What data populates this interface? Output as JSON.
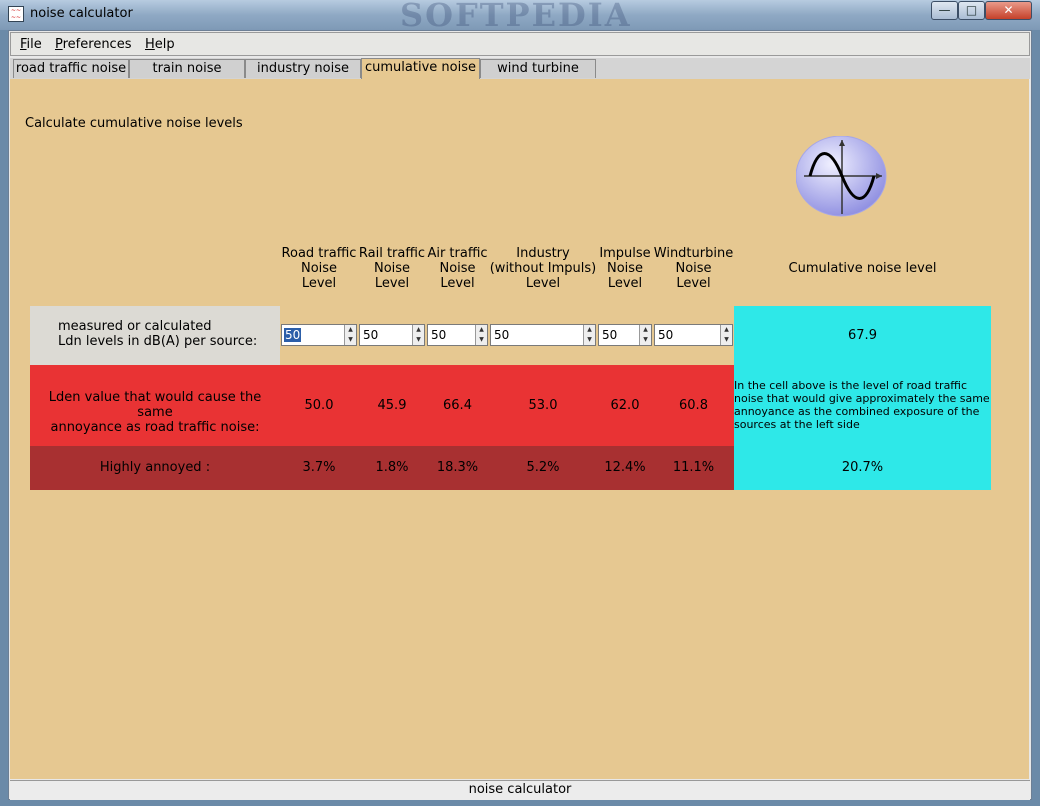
{
  "window": {
    "title": "noise calculator",
    "watermark": "SOFTPEDIA",
    "icon": "sine-wave-app-icon"
  },
  "menu": [
    {
      "label": "File",
      "mnemonic": "F"
    },
    {
      "label": "Preferences",
      "mnemonic": "P"
    },
    {
      "label": "Help",
      "mnemonic": "H"
    }
  ],
  "tabs": [
    {
      "label": "road traffic noise",
      "active": false
    },
    {
      "label": "train noise",
      "active": false
    },
    {
      "label": "industry noise",
      "active": false
    },
    {
      "label": "cumulative noise",
      "active": true
    },
    {
      "label": "wind turbine",
      "active": false
    }
  ],
  "page": {
    "heading": "Calculate cumulative noise levels",
    "logo_icon": "sine-wave-graph-icon"
  },
  "columns": [
    {
      "lines": [
        "Road traffic",
        "Noise",
        "Level"
      ]
    },
    {
      "lines": [
        "Rail traffic",
        "Noise",
        "Level"
      ]
    },
    {
      "lines": [
        "Air traffic",
        "Noise",
        "Level"
      ]
    },
    {
      "lines": [
        "Industry",
        "(without Impuls)",
        "Level"
      ]
    },
    {
      "lines": [
        "Impulse",
        "Noise",
        "Level"
      ]
    },
    {
      "lines": [
        "Windturbine",
        "Noise",
        "Level"
      ]
    }
  ],
  "cumulative_header": "Cumulative noise level",
  "rows": {
    "input_label_line1": "measured or calculated",
    "input_label_line2": "Ldn levels in dB(A) per source:",
    "inputs": [
      "50",
      "50",
      "50",
      "50",
      "50",
      "50"
    ],
    "lden_label_line1": "Lden value that would cause the same",
    "lden_label_line2": "annoyance as road traffic noise:",
    "lden_values": [
      "50.0",
      "45.9",
      "66.4",
      "53.0",
      "62.0",
      "60.8"
    ],
    "annoyed_label": "Highly annoyed :",
    "annoyed_values": [
      "3.7%",
      "1.8%",
      "18.3%",
      "5.2%",
      "12.4%",
      "11.1%"
    ]
  },
  "cumulative": {
    "level": "67.9",
    "explanation": "In the cell above is the level of road traffic noise that would give approximately the same annoyance as the combined exposure of the sources at the left side",
    "annoyed": "20.7%"
  },
  "status_bar": "noise calculator",
  "colors": {
    "content_bg": "#e6c891",
    "input_row_bg": "#dcdad4",
    "lden_row_bg": "#e93334",
    "annoyed_row_bg": "#a83031",
    "cumulative_bg": "#2ee8e8"
  }
}
